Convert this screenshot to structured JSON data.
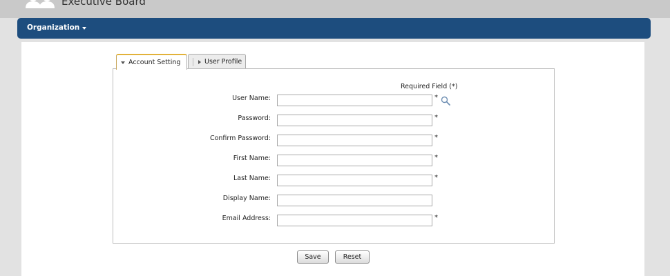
{
  "header": {
    "title": "Executive Board",
    "icon": "users-group-icon"
  },
  "nav": {
    "organization_label": "Organization"
  },
  "tabs": [
    {
      "label": "Account Setting",
      "active": true
    },
    {
      "label": "User Profile",
      "active": false
    }
  ],
  "form": {
    "required_note": "Required Field (*)",
    "fields": [
      {
        "label": "User Name:",
        "value": "",
        "required": true
      },
      {
        "label": "Password:",
        "value": "",
        "required": true
      },
      {
        "label": "Confirm Password:",
        "value": "",
        "required": true
      },
      {
        "label": "First Name:",
        "value": "",
        "required": true
      },
      {
        "label": "Last Name:",
        "value": "",
        "required": true
      },
      {
        "label": "Display Name:",
        "value": "",
        "required": false
      },
      {
        "label": "Email Address:",
        "value": "",
        "required": true
      }
    ],
    "star": "*"
  },
  "buttons": {
    "save_label": "Save",
    "reset_label": "Reset"
  },
  "colors": {
    "nav_bar": "#1d4d7e",
    "active_tab_accent": "#e2b23a"
  }
}
